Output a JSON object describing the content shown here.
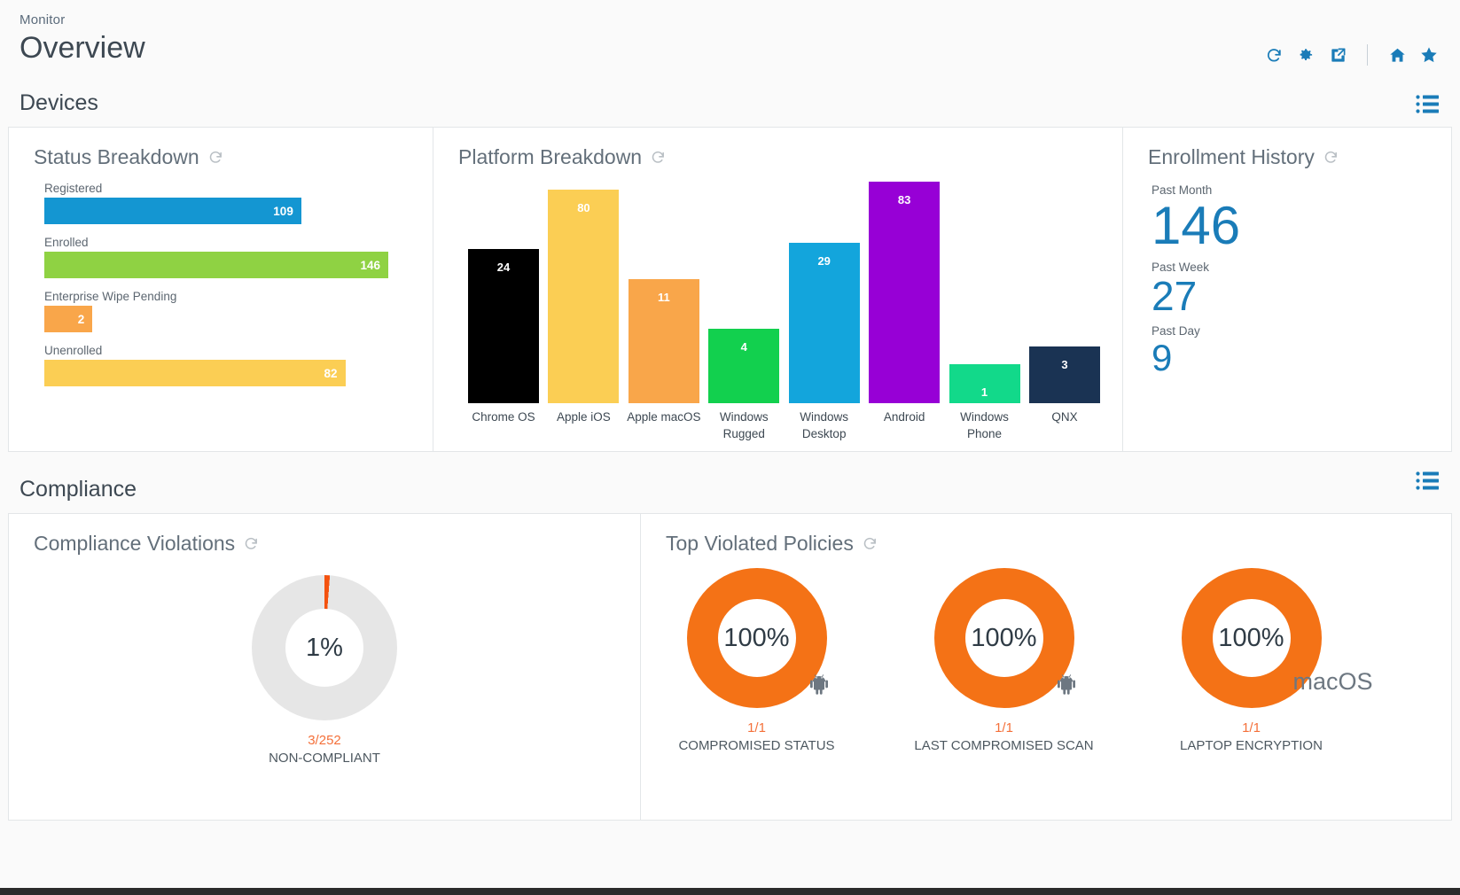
{
  "header": {
    "breadcrumb": "Monitor",
    "title": "Overview",
    "actions": [
      {
        "name": "refresh-icon",
        "label": "Refresh"
      },
      {
        "name": "gear-icon",
        "label": "Settings"
      },
      {
        "name": "external-link-icon",
        "label": "Open in new window"
      },
      {
        "name": "home-icon",
        "label": "Home"
      },
      {
        "name": "star-icon",
        "label": "Favorite"
      }
    ],
    "accent_color": "#1a7cb8"
  },
  "sections": {
    "devices": {
      "title": "Devices",
      "menu_icon": "list-icon"
    },
    "compliance": {
      "title": "Compliance",
      "menu_icon": "list-icon"
    }
  },
  "status_breakdown": {
    "title": "Status Breakdown",
    "refresh_icon": "refresh-icon"
  },
  "platform_breakdown": {
    "title": "Platform Breakdown",
    "refresh_icon": "refresh-icon"
  },
  "enrollment_history": {
    "title": "Enrollment History",
    "refresh_icon": "refresh-icon",
    "items": [
      {
        "label": "Past Month",
        "value": "146"
      },
      {
        "label": "Past Week",
        "value": "27"
      },
      {
        "label": "Past Day",
        "value": "9"
      }
    ]
  },
  "compliance_violations": {
    "title": "Compliance Violations",
    "refresh_icon": "refresh-icon",
    "percent_label": "1%",
    "ratio": "3/252",
    "caption": "NON-COMPLIANT"
  },
  "top_violated_policies": {
    "title": "Top Violated Policies",
    "refresh_icon": "refresh-icon",
    "items": [
      {
        "percent_label": "100%",
        "ratio": "1/1",
        "name": "COMPROMISED STATUS",
        "platform_icon": "android-icon",
        "platform_text": ""
      },
      {
        "percent_label": "100%",
        "ratio": "1/1",
        "name": "LAST COMPROMISED SCAN",
        "platform_icon": "android-icon",
        "platform_text": ""
      },
      {
        "percent_label": "100%",
        "ratio": "1/1",
        "name": "LAPTOP ENCRYPTION",
        "platform_icon": "text-badge",
        "platform_text": "macOS"
      }
    ]
  },
  "chart_data": [
    {
      "type": "bar",
      "orientation": "horizontal",
      "title": "Status Breakdown",
      "categories": [
        "Registered",
        "Enrolled",
        "Enterprise Wipe Pending",
        "Unenrolled"
      ],
      "values": [
        109,
        146,
        2,
        82
      ],
      "colors": [
        "#1496d2",
        "#8fd243",
        "#f9a councils",
        "#fbce54"
      ],
      "bar_colors": [
        "#1496d2",
        "#8fd243",
        "#f9a64a",
        "#fbce54"
      ],
      "xlabel": "",
      "ylabel": "",
      "xlim": [
        0,
        146
      ],
      "grid": false,
      "legend": false
    },
    {
      "type": "bar",
      "orientation": "vertical",
      "title": "Platform Breakdown",
      "categories": [
        "Chrome OS",
        "Apple iOS",
        "Apple macOS",
        "Windows Rugged",
        "Windows Desktop",
        "Android",
        "Windows Phone",
        "QNX"
      ],
      "values": [
        24,
        80,
        11,
        4,
        29,
        83,
        1,
        3
      ],
      "bar_colors": [
        "#000000",
        "#fbce54",
        "#f9a64a",
        "#12d04e",
        "#13a5dc",
        "#9700d6",
        "#12d98a",
        "#1a3353"
      ],
      "xlabel": "",
      "ylabel": "",
      "ylim": [
        0,
        83
      ],
      "grid": false,
      "legend": false
    },
    {
      "type": "pie",
      "subtype": "donut",
      "title": "Compliance Violations",
      "center_label": "1%",
      "slices": [
        {
          "name": "Non-compliant",
          "value": 3,
          "color": "#f4520f"
        },
        {
          "name": "Compliant",
          "value": 249,
          "color": "#e6e6e6"
        }
      ],
      "total": 252,
      "annotation": "3/252 NON-COMPLIANT"
    },
    {
      "type": "pie",
      "subtype": "donut",
      "title": "Top Violated Policies",
      "series": [
        {
          "name": "COMPROMISED STATUS",
          "center_label": "100%",
          "value": 1,
          "total": 1,
          "color": "#f47216"
        },
        {
          "name": "LAST COMPROMISED SCAN",
          "center_label": "100%",
          "value": 1,
          "total": 1,
          "color": "#f47216"
        },
        {
          "name": "LAPTOP ENCRYPTION",
          "center_label": "100%",
          "value": 1,
          "total": 1,
          "color": "#f47216"
        }
      ]
    }
  ]
}
